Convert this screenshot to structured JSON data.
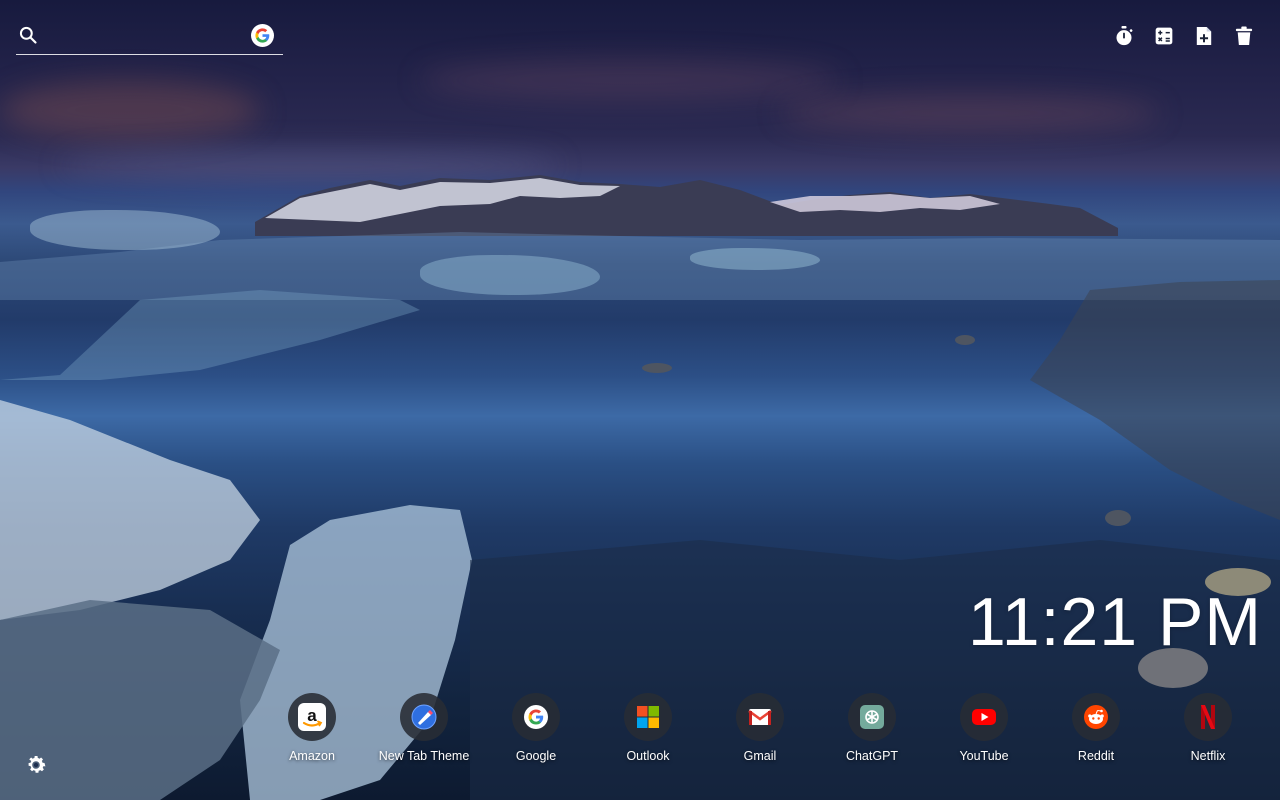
{
  "search": {
    "placeholder": "",
    "engine_icon": "google-icon"
  },
  "toolbar": {
    "items": [
      {
        "name": "timer",
        "icon": "stopwatch-icon"
      },
      {
        "name": "calculator",
        "icon": "calculator-icon"
      },
      {
        "name": "new-note",
        "icon": "add-document-icon"
      },
      {
        "name": "delete",
        "icon": "trash-icon"
      }
    ]
  },
  "clock": {
    "time": "11:21 PM"
  },
  "shortcuts": [
    {
      "label": "Amazon",
      "icon": "amazon-icon"
    },
    {
      "label": "New Tab Theme",
      "icon": "new-tab-theme-icon"
    },
    {
      "label": "Google",
      "icon": "google-icon"
    },
    {
      "label": "Outlook",
      "icon": "microsoft-icon"
    },
    {
      "label": "Gmail",
      "icon": "gmail-icon"
    },
    {
      "label": "ChatGPT",
      "icon": "chatgpt-icon"
    },
    {
      "label": "YouTube",
      "icon": "youtube-icon"
    },
    {
      "label": "Reddit",
      "icon": "reddit-icon"
    },
    {
      "label": "Netflix",
      "icon": "netflix-icon"
    }
  ],
  "settings": {
    "icon": "gear-icon"
  },
  "colors": {
    "text": "#ffffff",
    "tile_bg": "#282c34",
    "amazon": "#ff9900",
    "youtube": "#ff0000",
    "reddit": "#ff4500",
    "netflix": "#e50914",
    "chatgpt": "#74aa9c"
  }
}
